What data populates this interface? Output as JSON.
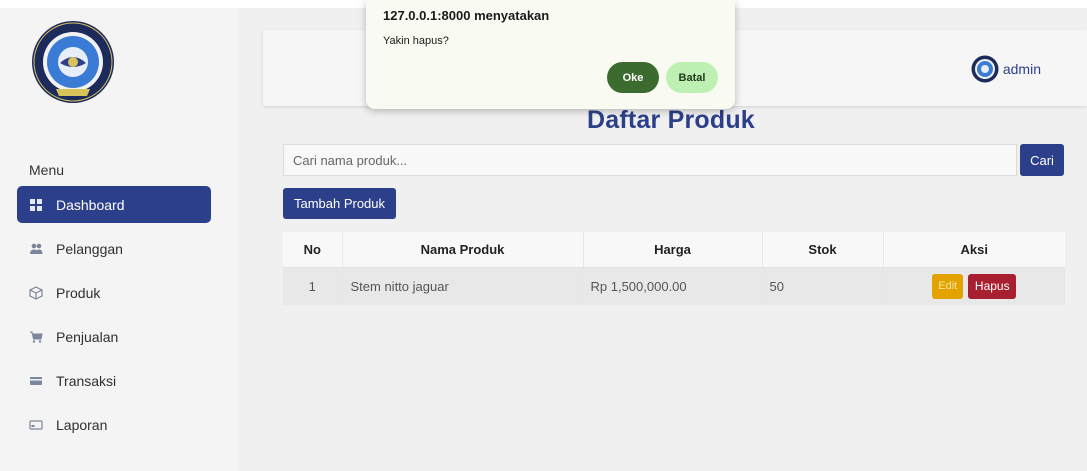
{
  "sidebar": {
    "menu_heading": "Menu",
    "items": [
      {
        "label": "Dashboard",
        "icon": "grid-icon",
        "active": true
      },
      {
        "label": "Pelanggan",
        "icon": "users-icon",
        "active": false
      },
      {
        "label": "Produk",
        "icon": "box-icon",
        "active": false
      },
      {
        "label": "Penjualan",
        "icon": "cart-icon",
        "active": false
      },
      {
        "label": "Transaksi",
        "icon": "card-icon",
        "active": false
      },
      {
        "label": "Laporan",
        "icon": "report-icon",
        "active": false
      }
    ]
  },
  "header": {
    "user_name": "admin"
  },
  "main": {
    "title": "Daftar Produk",
    "search": {
      "placeholder": "Cari nama produk...",
      "button_label": "Cari"
    },
    "add_button_label": "Tambah Produk",
    "table": {
      "columns": [
        "No",
        "Nama Produk",
        "Harga",
        "Stok",
        "Aksi"
      ],
      "rows": [
        {
          "no": "1",
          "name": "Stem nitto jaguar",
          "price": "Rp 1,500,000.00",
          "stock": "50",
          "edit_label": "Edit",
          "delete_label": "Hapus"
        }
      ]
    }
  },
  "dialog": {
    "title": "127.0.0.1:8000 menyatakan",
    "message": "Yakin hapus?",
    "ok_label": "Oke",
    "cancel_label": "Batal"
  },
  "colors": {
    "primary": "#2c3f8a",
    "sidebar_bg": "#f4f4f4",
    "main_bg": "#f0f0f0",
    "edit": "#e2a300",
    "delete": "#a82030",
    "dialog_ok": "#3c6b2f",
    "dialog_cancel": "#bff0b3"
  }
}
